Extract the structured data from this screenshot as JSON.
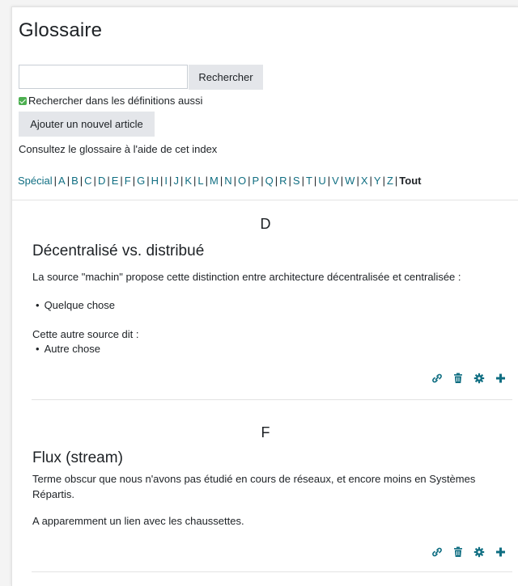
{
  "page": {
    "title": "Glossaire",
    "search": {
      "value": "",
      "button": "Rechercher"
    },
    "checkbox_label": "Rechercher dans les définitions aussi",
    "add_button": "Ajouter un nouvel article",
    "index_text": "Consultez le glossaire à l'aide de cet index",
    "alphabet": [
      "Spécial",
      "A",
      "B",
      "C",
      "D",
      "E",
      "F",
      "G",
      "H",
      "I",
      "J",
      "K",
      "L",
      "M",
      "N",
      "O",
      "P",
      "Q",
      "R",
      "S",
      "T",
      "U",
      "V",
      "W",
      "X",
      "Y",
      "Z"
    ],
    "alphabet_current": "Tout"
  },
  "entries": [
    {
      "letter": "D",
      "title": "Décentralisé vs. distribué",
      "p1": "La source \"machin\" propose cette distinction entre architecture décentralisée et centralisée :",
      "bullet1": "Quelque chose",
      "p2": "Cette autre source dit :",
      "bullet2": "Autre chose"
    },
    {
      "letter": "F",
      "title": "Flux (stream)",
      "p1": "Terme obscur que nous n'avons pas étudié en cours de réseaux, et encore moins en Systèmes Répartis.",
      "p2": "A apparemment un lien avec les chaussettes."
    }
  ],
  "icons": [
    "link-icon",
    "trash-icon",
    "gear-icon",
    "plus-icon"
  ],
  "colors": {
    "accent": "#0f6e82",
    "button_bg": "#e4e6ea",
    "checkbox": "#4caf50"
  }
}
